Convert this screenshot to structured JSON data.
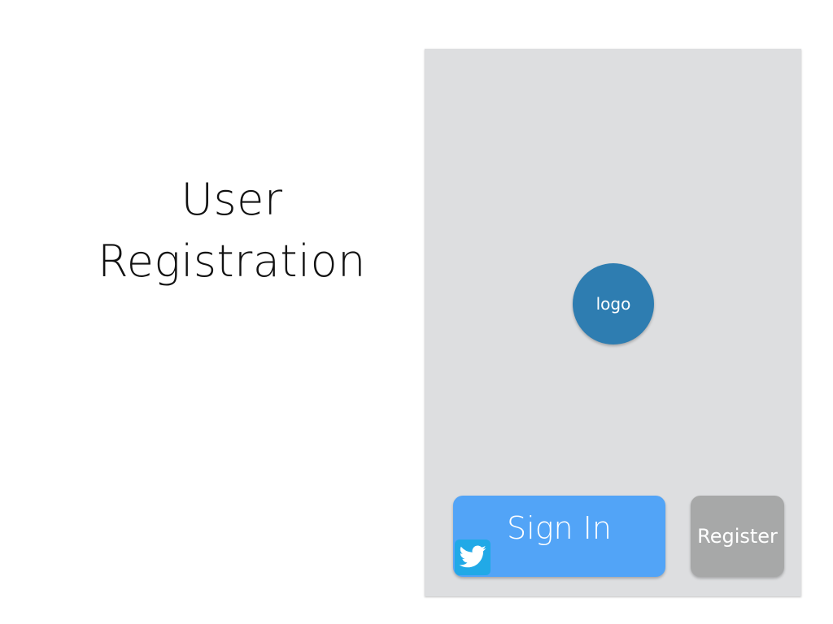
{
  "slide": {
    "title_line1": "User",
    "title_line2": "Registration"
  },
  "screen": {
    "logo_label": "logo",
    "signin_label": "Sign In",
    "register_label": "Register",
    "signin_icon": "twitter-bird-icon"
  },
  "colors": {
    "panel_background": "#dddee0",
    "logo": "#2e7db1",
    "signin": "#52a4f7",
    "twitter": "#21a9e7",
    "register": "#a7a8a8"
  }
}
